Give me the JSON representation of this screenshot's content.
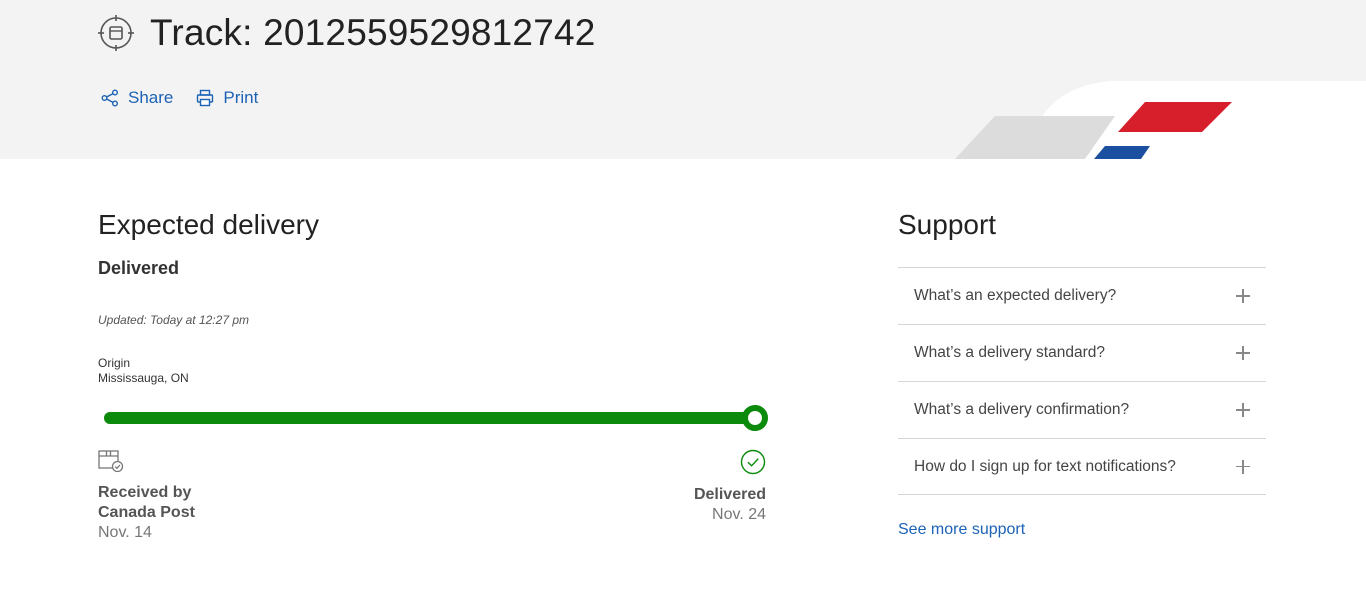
{
  "header": {
    "title_prefix": "Track:",
    "tracking_number": "2012559529812742",
    "share_label": "Share",
    "print_label": "Print"
  },
  "delivery": {
    "section_title": "Expected delivery",
    "status": "Delivered",
    "updated": "Updated: Today at 12:27 pm",
    "origin_label": "Origin",
    "origin_value": "Mississauga, ON",
    "progress_percent": 100,
    "start": {
      "title_line1": "Received by",
      "title_line2": "Canada Post",
      "date": "Nov. 14"
    },
    "end": {
      "title": "Delivered",
      "date": "Nov. 24"
    }
  },
  "support": {
    "section_title": "Support",
    "faqs": [
      {
        "label": "What’s an expected delivery?"
      },
      {
        "label": "What’s a delivery standard?"
      },
      {
        "label": "What’s a delivery confirmation?"
      },
      {
        "label": "How do I sign up for text notifications?"
      }
    ],
    "see_more": "See more support"
  },
  "colors": {
    "link": "#1c62b6",
    "progress": "#0b8a0b",
    "brand_red": "#d61f2b",
    "brand_blue": "#1b4fa0"
  },
  "icons": [
    "track-icon",
    "share-icon",
    "print-icon",
    "package-icon",
    "check-circle-icon",
    "plus-icon"
  ]
}
